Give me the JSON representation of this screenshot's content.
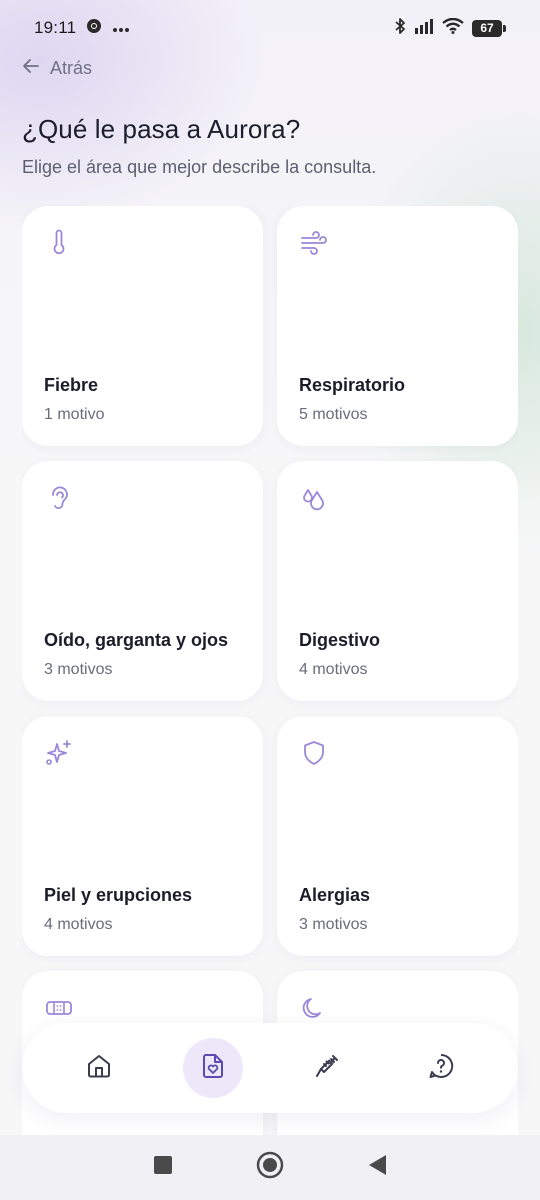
{
  "status_bar": {
    "time": "19:11",
    "battery": "67"
  },
  "header": {
    "back_label": "Atrás",
    "title": "¿Qué le pasa a Aurora?",
    "subtitle": "Elige el área que mejor describe la consulta."
  },
  "categories": [
    {
      "label": "Fiebre",
      "count": "1 motivo",
      "icon": "thermometer-icon"
    },
    {
      "label": "Respiratorio",
      "count": "5 motivos",
      "icon": "wind-icon"
    },
    {
      "label": "Oído, garganta y ojos",
      "count": "3 motivos",
      "icon": "ear-icon"
    },
    {
      "label": "Digestivo",
      "count": "4 motivos",
      "icon": "droplets-icon"
    },
    {
      "label": "Piel y erupciones",
      "count": "4 motivos",
      "icon": "sparkles-icon"
    },
    {
      "label": "Alergias",
      "count": "3 motivos",
      "icon": "shield-icon"
    },
    {
      "label": "",
      "count": "",
      "icon": "bandage-icon"
    },
    {
      "label": "",
      "count": "",
      "icon": "moon-icon"
    }
  ],
  "bottom_nav": {
    "items": [
      {
        "icon": "home-icon",
        "active": false
      },
      {
        "icon": "document-heart-icon",
        "active": true
      },
      {
        "icon": "syringe-icon",
        "active": false
      },
      {
        "icon": "help-icon",
        "active": false
      }
    ]
  },
  "colors": {
    "accent": "#9a88d9",
    "accent_dark": "#5b4bb0",
    "text": "#1c1d29",
    "muted": "#6a6c7c",
    "active_bg": "#ece8f9"
  }
}
